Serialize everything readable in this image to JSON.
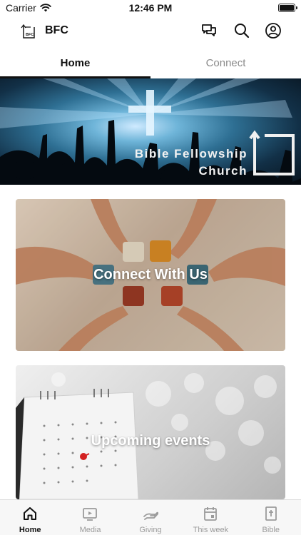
{
  "status_bar": {
    "carrier": "Carrier",
    "time": "12:46 PM",
    "wifi_icon": "wifi-icon",
    "battery_icon": "battery-icon"
  },
  "app_bar": {
    "logo_text": "BFC",
    "title": "BFC",
    "icons": [
      "chat-bubbles-icon",
      "search-icon",
      "profile-icon"
    ]
  },
  "tabs": [
    {
      "label": "Home",
      "active": true
    },
    {
      "label": "Connect",
      "active": false
    }
  ],
  "hero": {
    "line1": "Bible Fellowship",
    "line2": "Church"
  },
  "cards": [
    {
      "title": "Connect With Us"
    },
    {
      "title": "Upcoming events"
    }
  ],
  "bottom_nav": [
    {
      "label": "Home",
      "icon": "home-icon",
      "active": true
    },
    {
      "label": "Media",
      "icon": "media-icon",
      "active": false
    },
    {
      "label": "Giving",
      "icon": "giving-icon",
      "active": false
    },
    {
      "label": "This week",
      "icon": "calendar-icon",
      "active": false
    },
    {
      "label": "Bible",
      "icon": "bible-icon",
      "active": false
    }
  ],
  "colors": {
    "accent": "#111111",
    "inactive": "#8a8a8a",
    "nav_bg": "#f7f7f7"
  }
}
